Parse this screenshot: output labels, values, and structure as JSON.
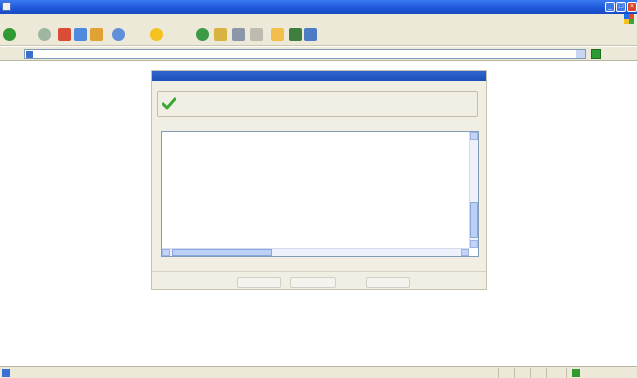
{
  "window": {
    "title": ""
  },
  "menubar": {
    "items": [
      "",
      "",
      "",
      "",
      "",
      ""
    ]
  },
  "toolbar": {
    "back_label": "",
    "search_label": "",
    "favorites_label": ""
  },
  "addressbar": {
    "label": "",
    "url": "",
    "go_label": "",
    "links_label": ""
  },
  "wizard": {
    "header_title": "",
    "status_legend": "",
    "status_message": "",
    "log_lines": [
      "",
      "",
      "",
      "",
      "",
      "",
      "",
      "",
      "",
      "",
      "",
      "",
      "",
      "",
      "",
      "",
      "",
      "",
      "",
      "",
      "",
      "",
      "",
      "",
      "",
      "",
      "",
      "",
      ""
    ],
    "buttons": {
      "back": "",
      "finish": "",
      "cancel": ""
    }
  },
  "statusbar": {
    "zone": ""
  },
  "colors": {
    "title_blue": "#1d55d8",
    "chrome": "#ece9d8",
    "panel_bg": "#f1efe4",
    "success_green": "#39a935"
  }
}
